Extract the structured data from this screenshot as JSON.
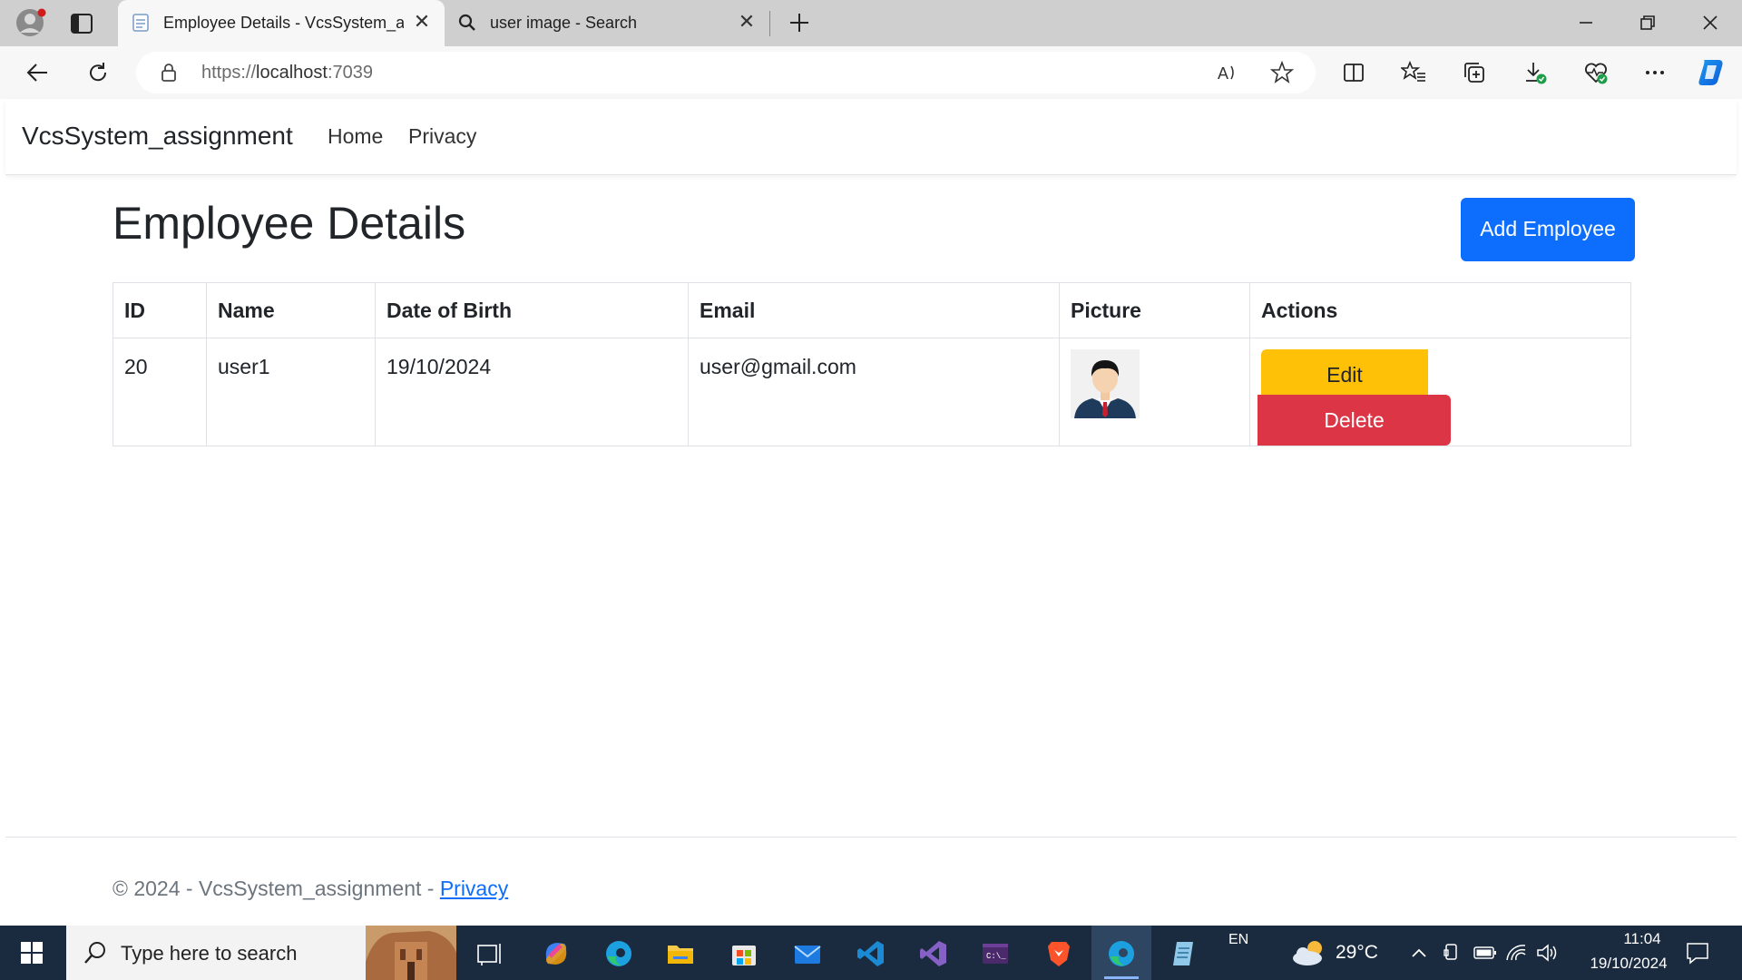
{
  "browser": {
    "active_tab_title": "Employee Details - VcsSystem_assignment",
    "inactive_tab_title": "user image - Search",
    "url_scheme": "https://",
    "url_host": "localhost",
    "url_port": ":7039",
    "icons": [
      "profile-icon",
      "tab-actions-icon",
      "page-favicon",
      "search-icon",
      "close-icon",
      "new-tab-icon",
      "minimize-icon",
      "restore-icon",
      "window-close-icon",
      "back-icon",
      "refresh-icon",
      "lock-icon",
      "read-aloud-icon",
      "favorite-star-icon",
      "split-screen-icon",
      "favorites-icon",
      "collections-icon",
      "downloads-icon",
      "browser-essentials-icon",
      "more-icon",
      "copilot-icon"
    ]
  },
  "navbar": {
    "brand": "VcsSystem_assignment",
    "links": [
      "Home",
      "Privacy"
    ]
  },
  "page": {
    "title": "Employee Details",
    "add_button": "Add Employee",
    "table": {
      "headers": [
        "ID",
        "Name",
        "Date of Birth",
        "Email",
        "Picture",
        "Actions"
      ],
      "rows": [
        {
          "id": "20",
          "name": "user1",
          "dob": "19/10/2024",
          "email": "user@gmail.com",
          "picture": "user-avatar-icon",
          "edit": "Edit",
          "delete": "Delete"
        }
      ]
    }
  },
  "footer": {
    "text": "© 2024 - VcsSystem_assignment - ",
    "link": "Privacy"
  },
  "taskbar": {
    "search_placeholder": "Type here to search",
    "language": "EN",
    "weather": "29°C",
    "time": "11:04",
    "date": "19/10/2024"
  },
  "colors": {
    "primary": "#0d6efd",
    "warning": "#ffc107",
    "danger": "#dc3545",
    "taskbar": "#1b2b3f"
  }
}
